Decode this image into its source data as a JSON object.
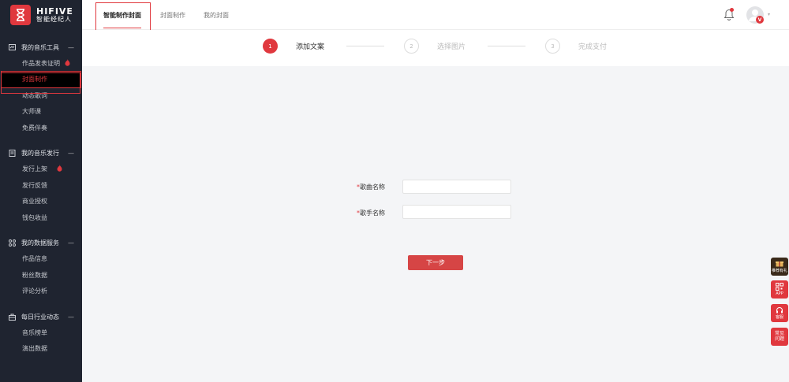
{
  "brand": {
    "name_en": "HIFIVE",
    "name_cn": "智能经纪人"
  },
  "sidebar": {
    "groups": [
      {
        "title": "我的音乐工具",
        "icon": "music-tool-icon",
        "items": [
          {
            "label": "作品发表证明",
            "hot": true
          },
          {
            "label": "封面制作",
            "active": true
          },
          {
            "label": "动态歌词"
          },
          {
            "label": "大师课"
          },
          {
            "label": "免费伴奏"
          }
        ]
      },
      {
        "title": "我的音乐发行",
        "icon": "document-icon",
        "items": [
          {
            "label": "发行上架",
            "hot": true
          },
          {
            "label": "发行反馈"
          },
          {
            "label": "商业授权"
          },
          {
            "label": "钱包收益"
          }
        ]
      },
      {
        "title": "我的数据服务",
        "icon": "grid-icon",
        "items": [
          {
            "label": "作品信息"
          },
          {
            "label": "粉丝数据"
          },
          {
            "label": "评论分析"
          }
        ]
      },
      {
        "title": "每日行业动态",
        "icon": "briefcase-icon",
        "items": [
          {
            "label": "音乐榜单"
          },
          {
            "label": "演出数据"
          }
        ]
      }
    ],
    "collapse_symbol": "—",
    "hot_symbol": "🔥"
  },
  "topbar": {
    "tabs": [
      {
        "label": "智能制作封面",
        "active": true
      },
      {
        "label": "封面制作"
      },
      {
        "label": "我的封面"
      }
    ],
    "avatar_badge": "V",
    "caret": "▾"
  },
  "steps": [
    {
      "number": "1",
      "label": "添加文案",
      "active": true
    },
    {
      "number": "2",
      "label": "选择图片"
    },
    {
      "number": "3",
      "label": "完成支付"
    }
  ],
  "form": {
    "required_mark": "*",
    "song_label": "歌曲名称",
    "song_value": "",
    "singer_label": "歌手名称",
    "singer_value": "",
    "next_label": "下一步"
  },
  "float_buttons": [
    {
      "label": "推荐有礼",
      "glyph": "🎁"
    },
    {
      "label": "APP",
      "glyph": "▦"
    },
    {
      "label": "客服",
      "glyph": "◔"
    },
    {
      "label": "常见问题",
      "glyph": ""
    }
  ],
  "colors": {
    "accent": "#e0383e",
    "sidebar_bg": "#1f2430"
  }
}
